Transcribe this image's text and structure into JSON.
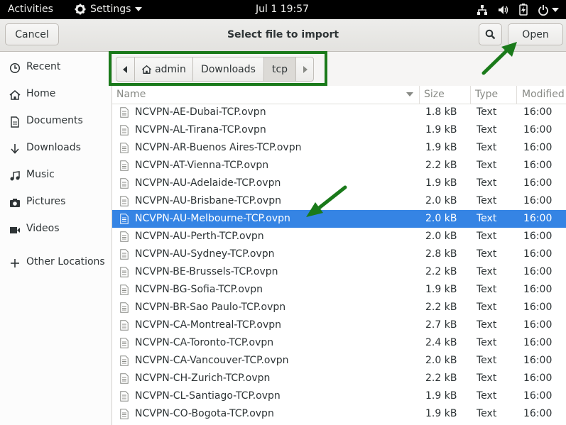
{
  "topbar": {
    "activities": "Activities",
    "app_menu": "Settings",
    "clock": "Jul 1  19:57",
    "tray_icons": [
      "network-icon",
      "volume-icon",
      "battery-icon",
      "power-icon"
    ]
  },
  "dialog": {
    "title": "Select file to import",
    "cancel_label": "Cancel",
    "open_label": "Open",
    "search_icon": "search-icon"
  },
  "sidebar": {
    "items": [
      {
        "label": "Recent",
        "icon": "clock-icon"
      },
      {
        "label": "Home",
        "icon": "home-icon"
      },
      {
        "label": "Documents",
        "icon": "document-icon"
      },
      {
        "label": "Downloads",
        "icon": "download-icon"
      },
      {
        "label": "Music",
        "icon": "music-icon"
      },
      {
        "label": "Pictures",
        "icon": "camera-icon"
      },
      {
        "label": "Videos",
        "icon": "video-icon"
      },
      {
        "label": "Other Locations",
        "icon": "plus-icon"
      }
    ]
  },
  "pathbar": {
    "segments": [
      "admin",
      "Downloads",
      "tcp"
    ],
    "active": "tcp"
  },
  "columns": {
    "name": "Name",
    "size": "Size",
    "type": "Type",
    "modified": "Modified"
  },
  "files": [
    {
      "name": "NCVPN-AE-Dubai-TCP.ovpn",
      "size": "1.8 kB",
      "type": "Text",
      "modified": "16:00"
    },
    {
      "name": "NCVPN-AL-Tirana-TCP.ovpn",
      "size": "1.9 kB",
      "type": "Text",
      "modified": "16:00"
    },
    {
      "name": "NCVPN-AR-Buenos Aires-TCP.ovpn",
      "size": "1.9 kB",
      "type": "Text",
      "modified": "16:00"
    },
    {
      "name": "NCVPN-AT-Vienna-TCP.ovpn",
      "size": "2.2 kB",
      "type": "Text",
      "modified": "16:00"
    },
    {
      "name": "NCVPN-AU-Adelaide-TCP.ovpn",
      "size": "1.9 kB",
      "type": "Text",
      "modified": "16:00"
    },
    {
      "name": "NCVPN-AU-Brisbane-TCP.ovpn",
      "size": "2.0 kB",
      "type": "Text",
      "modified": "16:00"
    },
    {
      "name": "NCVPN-AU-Melbourne-TCP.ovpn",
      "size": "2.0 kB",
      "type": "Text",
      "modified": "16:00",
      "selected": true
    },
    {
      "name": "NCVPN-AU-Perth-TCP.ovpn",
      "size": "2.0 kB",
      "type": "Text",
      "modified": "16:00"
    },
    {
      "name": "NCVPN-AU-Sydney-TCP.ovpn",
      "size": "2.8 kB",
      "type": "Text",
      "modified": "16:00"
    },
    {
      "name": "NCVPN-BE-Brussels-TCP.ovpn",
      "size": "2.2 kB",
      "type": "Text",
      "modified": "16:00"
    },
    {
      "name": "NCVPN-BG-Sofia-TCP.ovpn",
      "size": "1.9 kB",
      "type": "Text",
      "modified": "16:00"
    },
    {
      "name": "NCVPN-BR-Sao Paulo-TCP.ovpn",
      "size": "2.2 kB",
      "type": "Text",
      "modified": "16:00"
    },
    {
      "name": "NCVPN-CA-Montreal-TCP.ovpn",
      "size": "2.7 kB",
      "type": "Text",
      "modified": "16:00"
    },
    {
      "name": "NCVPN-CA-Toronto-TCP.ovpn",
      "size": "2.4 kB",
      "type": "Text",
      "modified": "16:00"
    },
    {
      "name": "NCVPN-CA-Vancouver-TCP.ovpn",
      "size": "2.0 kB",
      "type": "Text",
      "modified": "16:00"
    },
    {
      "name": "NCVPN-CH-Zurich-TCP.ovpn",
      "size": "2.2 kB",
      "type": "Text",
      "modified": "16:00"
    },
    {
      "name": "NCVPN-CL-Santiago-TCP.ovpn",
      "size": "1.9 kB",
      "type": "Text",
      "modified": "16:00"
    },
    {
      "name": "NCVPN-CO-Bogota-TCP.ovpn",
      "size": "1.9 kB",
      "type": "Text",
      "modified": "16:00"
    }
  ],
  "colors": {
    "selection": "#3584e4",
    "annotation": "#1a7a1a"
  }
}
